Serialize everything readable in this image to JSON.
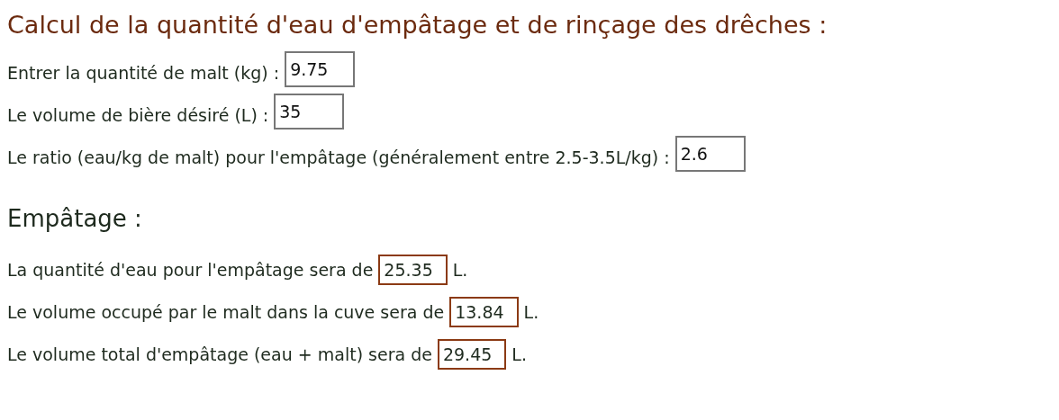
{
  "title": "Calcul de la quantité d'eau d'empâtage et de rinçage des drêches :",
  "inputs": [
    {
      "label": "Entrer la quantité de malt (kg) :",
      "value": "9.75"
    },
    {
      "label": "Le volume de bière désiré (L)  :",
      "value": "35"
    },
    {
      "label": "Le ratio (eau/kg de malt) pour l'empâtage (généralement entre 2.5-3.5L/kg)  :",
      "value": "2.6"
    }
  ],
  "section": {
    "heading": "Empâtage :",
    "results": [
      {
        "label": "La quantité d'eau pour l'empâtage sera de",
        "value": "25.35",
        "unit": "L."
      },
      {
        "label": "Le volume occupé par le malt dans la cuve sera de",
        "value": "13.84",
        "unit": "L."
      },
      {
        "label": "Le volume total d'empâtage (eau + malt) sera de",
        "value": "29.45",
        "unit": "L."
      }
    ]
  }
}
